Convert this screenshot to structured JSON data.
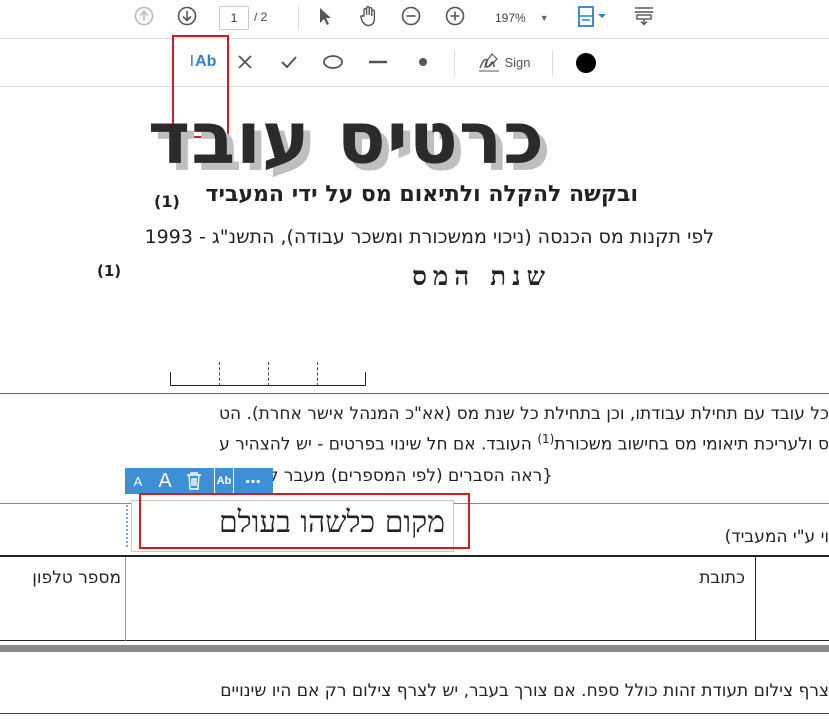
{
  "toolbar": {
    "page_current": "1",
    "page_total": "/ 2",
    "zoom": "197%",
    "icons": [
      "arrow-up-icon",
      "arrow-down-icon",
      "pointer-icon",
      "hand-icon",
      "zoom-out-icon",
      "zoom-in-icon",
      "fit-page-icon",
      "scroll-mode-icon"
    ]
  },
  "fill_sign_bar": {
    "text_tool_label": "Ab",
    "sign_label": "Sign",
    "tools": [
      "add-text-icon",
      "cross-icon",
      "checkmark-icon",
      "circle-icon",
      "line-icon",
      "dot-icon",
      "sign-icon",
      "color-swatch-icon"
    ],
    "color": "#000000"
  },
  "document": {
    "title": "כרטיס עובד",
    "title_sup": "(1)",
    "subtitle": "ובקשה להקלה ולתיאום מס על ידי המעביד",
    "subtitle_sup": "(1)",
    "regulation_line": "לפי תקנות מס הכנסה (ניכוי ממשכורת ומשכר עבודה), התשנ\"ג - 1993",
    "tax_year_label": "שנת המס",
    "para_line1": "כל עובד עם תחילת עבודתו, וכן בתחילת כל שנת מס (אא\"כ המנהל אישר אחרת). הט",
    "para_line2": "ס ולעריכת תיאומי מס בחישוב משכורת",
    "para_line2_sup": "(1)",
    "para_line2_rest": "העובד. אם חל שינוי בפרטים - יש להצהיר ע",
    "para_line3": "{ראה הסברים (לפי המספרים) מעבר לדף}",
    "section_label": "וי ע\"י המעביד)",
    "address_label": "כתובת",
    "phone_label": "מספר טלפון",
    "field_value": "מקום כלשהו בעולם",
    "bottom_line": "צרף צילום תעודת זהות כולל ספח. אם צורך בעבר, יש לצרף צילום רק אם היו שינויים"
  },
  "field_toolbar": {
    "small_a": "A",
    "big_a": "A",
    "ab_label": "Ab",
    "more_label": "⋯"
  },
  "colors": {
    "highlight": "#d71a20",
    "accent_blue": "#3d8fd6",
    "text": "#222222"
  }
}
